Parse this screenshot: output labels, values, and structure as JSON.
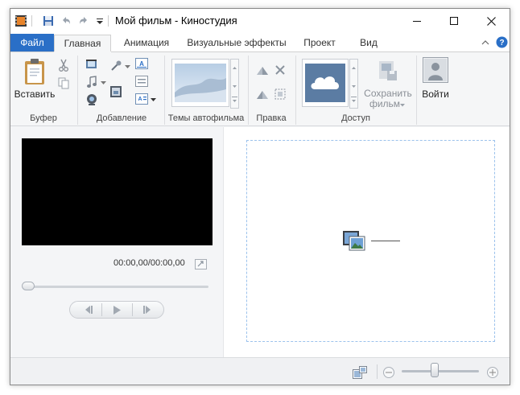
{
  "window": {
    "title": "Мой фильм - Киностудия"
  },
  "tabs": [
    "Файл",
    "Главная",
    "Анимация",
    "Визуальные эффекты",
    "Проект",
    "Вид"
  ],
  "ribbon": {
    "paste_label": "Вставить",
    "save_movie_label_line1": "Сохранить",
    "save_movie_label_line2": "фильм",
    "signin_label": "Войти",
    "groups": {
      "clipboard": "Буфер",
      "add": "Добавление",
      "themes": "Темы автофильма",
      "edit": "Правка",
      "share": "Доступ"
    }
  },
  "preview": {
    "timecode": "00:00,00/00:00,00"
  },
  "colors": {
    "file_tab": "#2a6fc7",
    "accent": "#2a6fc7",
    "drop_border": "#9cc2ec"
  }
}
